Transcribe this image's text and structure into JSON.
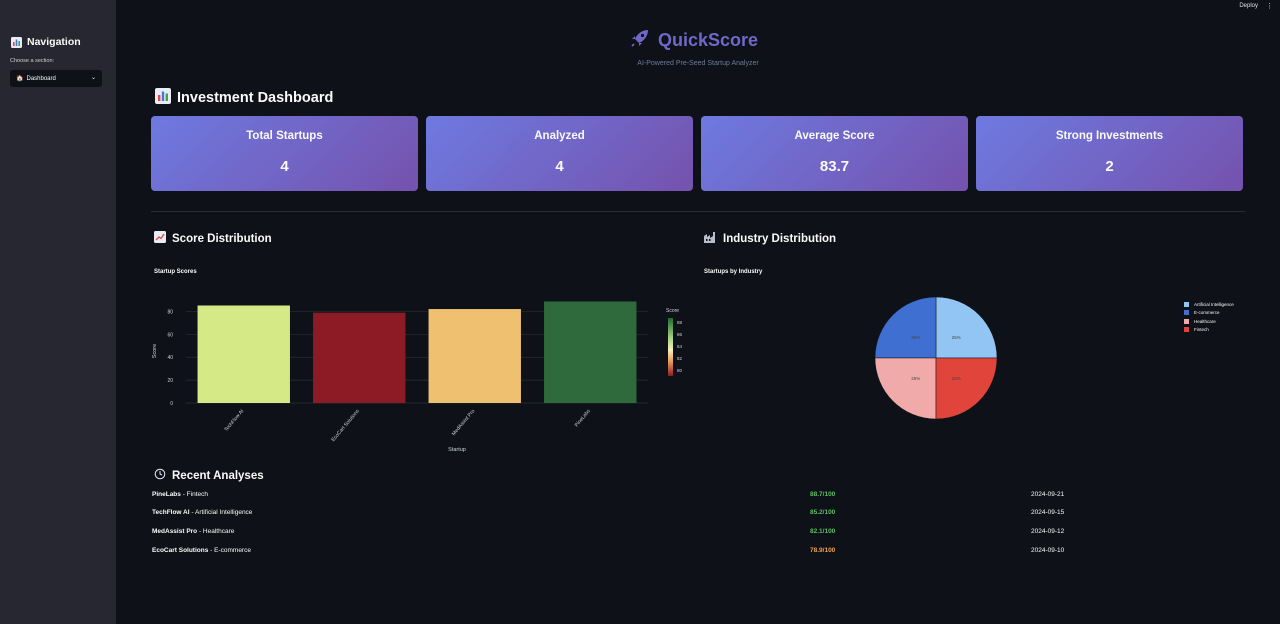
{
  "topbar": {
    "deploy": "Deploy",
    "menu": "⋮"
  },
  "sidebar": {
    "title": "Navigation",
    "select_label": "Choose a section:",
    "select_value": "Dashboard"
  },
  "hero": {
    "title": "QuickScore",
    "subtitle": "AI-Powered Pre-Seed Startup Analyzer"
  },
  "dashboard": {
    "title": "Investment Dashboard",
    "metrics": [
      {
        "label": "Total Startups",
        "value": "4"
      },
      {
        "label": "Analyzed",
        "value": "4"
      },
      {
        "label": "Average Score",
        "value": "83.7"
      },
      {
        "label": "Strong Investments",
        "value": "2"
      }
    ]
  },
  "score_section": {
    "title": "Score Distribution",
    "chart_title": "Startup Scores"
  },
  "industry_section": {
    "title": "Industry Distribution",
    "chart_title": "Startups by Industry"
  },
  "chart_data": [
    {
      "type": "bar",
      "title": "Startup Scores",
      "xlabel": "Startup",
      "ylabel": "Score",
      "categories": [
        "TechFlow AI",
        "EcoCart Solutions",
        "MedAssist Pro",
        "PineLabs"
      ],
      "values": [
        85.2,
        78.9,
        82.1,
        88.7
      ],
      "ylim": [
        0,
        90
      ],
      "yticks": [
        "0",
        "20",
        "40",
        "60",
        "80"
      ],
      "colorbar": {
        "title": "Score",
        "ticks": [
          "88",
          "86",
          "84",
          "82",
          "80"
        ]
      },
      "colors": [
        "#d5e987",
        "#8c1b25",
        "#efc070",
        "#2f6a3c"
      ]
    },
    {
      "type": "pie",
      "title": "Startups by Industry",
      "labels": [
        "Artificial Intelligence",
        "E-commerce",
        "Healthcare",
        "Fintech"
      ],
      "values": [
        25,
        25,
        25,
        25
      ],
      "slice_labels": [
        "25%",
        "25%",
        "25%",
        "25%"
      ],
      "colors": [
        "#93c5f4",
        "#3f6fd0",
        "#f0aaaa",
        "#e0443a"
      ],
      "legend_position": "right"
    }
  ],
  "recent": {
    "title": "Recent Analyses",
    "rows": [
      {
        "name": "PineLabs",
        "industry": " - Fintech",
        "score": "88.7/100",
        "date": "2024-09-21",
        "color": "#5fbf62"
      },
      {
        "name": "TechFlow AI",
        "industry": " - Artificial Intelligence",
        "score": "85.2/100",
        "date": "2024-09-15",
        "color": "#5fbf62"
      },
      {
        "name": "MedAssist Pro",
        "industry": " - Healthcare",
        "score": "82.1/100",
        "date": "2024-09-12",
        "color": "#5fbf62"
      },
      {
        "name": "EcoCart Solutions",
        "industry": " - E-commerce",
        "score": "78.9/100",
        "date": "2024-09-10",
        "color": "#f0a24a"
      }
    ]
  }
}
